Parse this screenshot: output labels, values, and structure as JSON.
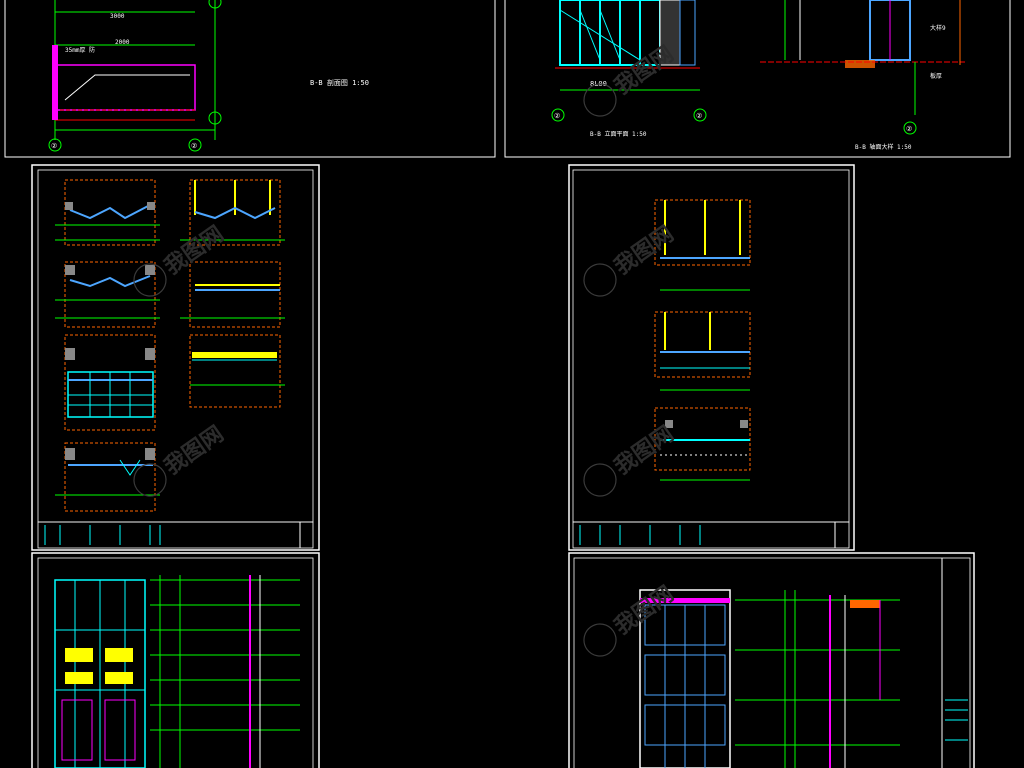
{
  "drawing": {
    "background": "#000000",
    "colors": {
      "frame": "#ffffff",
      "dim": "#00ff00",
      "grid": "#00ffff",
      "wall": "#ffff00",
      "glass": "#4da6ff",
      "hatch": "#ff00ff",
      "bound": "#ff6600",
      "accent": "#ff0000"
    }
  },
  "top_left_view": {
    "caption": "B-B 剖面图  1:50",
    "axis_labels": [
      "②",
      "②"
    ]
  },
  "top_right_view": {
    "caption_left": "B-B 立面平面  1:50",
    "caption_right": "B-B 轴面大样  1:50",
    "dimension": "8L00",
    "axis_labels": [
      "②",
      "②",
      "②"
    ]
  },
  "sheets": [
    {
      "name": "sheet-details-a",
      "title_block": ""
    },
    {
      "name": "sheet-details-b",
      "title_block": ""
    },
    {
      "name": "sheet-elevation-c",
      "title_block": ""
    },
    {
      "name": "sheet-elevation-d",
      "title_block": ""
    }
  ],
  "watermark": {
    "text": "我图网",
    "icon": "watermark-logo-icon"
  }
}
